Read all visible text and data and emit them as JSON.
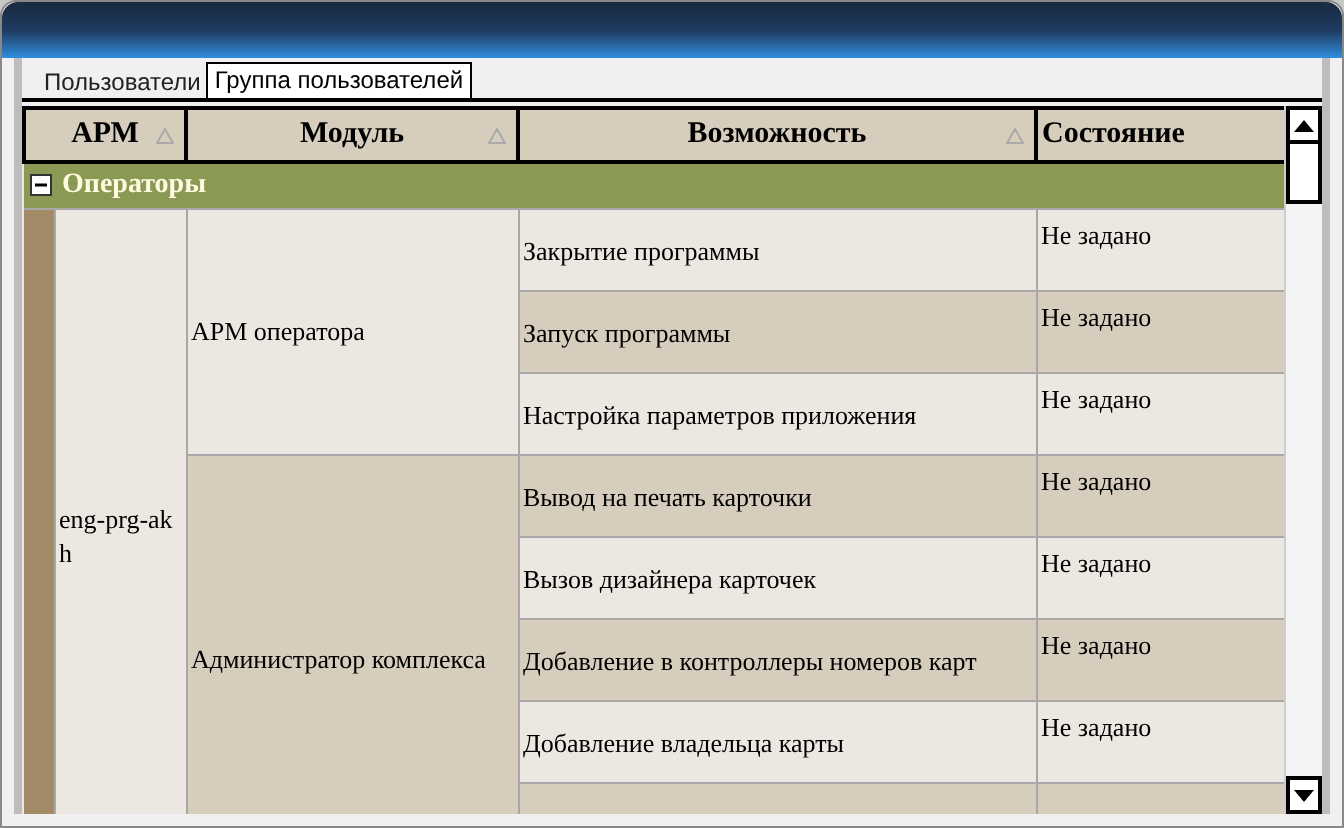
{
  "tabs": [
    {
      "label": "Пользователи",
      "selected": false
    },
    {
      "label": "Группа пользователей",
      "selected": true
    }
  ],
  "table": {
    "columns": [
      {
        "label": "АРМ",
        "sortable": true
      },
      {
        "label": "Модуль",
        "sortable": true
      },
      {
        "label": "Возможность",
        "sortable": true
      },
      {
        "label": "Состояние",
        "sortable": false
      }
    ],
    "groups": [
      {
        "name": "Операторы",
        "expanded": true,
        "workstations": [
          {
            "name": "eng-prg-akh",
            "modules": [
              {
                "name": "АРМ оператора",
                "features": [
                  {
                    "name": "Закрытие программы",
                    "state": "Не задано"
                  },
                  {
                    "name": "Запуск программы",
                    "state": "Не задано"
                  },
                  {
                    "name": "Настройка параметров приложения",
                    "state": "Не задано"
                  }
                ]
              },
              {
                "name": "Администратор комплекса",
                "features": [
                  {
                    "name": "Вывод на печать карточки",
                    "state": "Не задано"
                  },
                  {
                    "name": "Вызов дизайнера карточек",
                    "state": "Не задано"
                  },
                  {
                    "name": "Добавление в контроллеры номеров карт",
                    "state": "Не задано"
                  },
                  {
                    "name": "Добавление владельца карты",
                    "state": "Не задано"
                  }
                ]
              }
            ]
          }
        ]
      }
    ]
  }
}
